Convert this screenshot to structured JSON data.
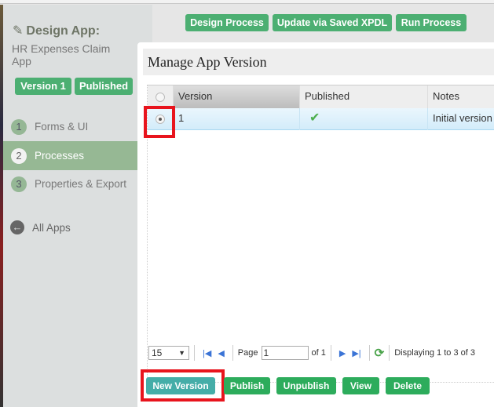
{
  "sidebar": {
    "title": "Design App:",
    "app_name": "HR Expenses Claim App",
    "version_badge": "Version 1",
    "published_badge": "Published",
    "nav": [
      {
        "num": "1",
        "label": "Forms & UI"
      },
      {
        "num": "2",
        "label": "Processes",
        "active": true
      },
      {
        "num": "3",
        "label": "Properties & Export"
      }
    ],
    "all_apps": "All Apps"
  },
  "toolbar": {
    "design_process": "Design Process",
    "update_xpdl": "Update via Saved XPDL",
    "run_process": "Run Process"
  },
  "modal": {
    "title": "Manage App Version",
    "columns": [
      "Version",
      "Published",
      "Notes"
    ],
    "rows": [
      {
        "version": "1",
        "published": true,
        "notes": "Initial version",
        "selected": true
      }
    ],
    "pager": {
      "page_size": "15",
      "page_label": "Page",
      "page_value": "1",
      "of_label": "of 1",
      "display_text": "Displaying 1 to 3 of 3"
    },
    "actions": {
      "new_version": "New Version",
      "publish": "Publish",
      "unpublish": "Unpublish",
      "view": "View",
      "delete": "Delete"
    }
  },
  "colors": {
    "accent_green": "#4caf72",
    "action_green": "#2dac5c",
    "new_version_teal": "#45ada8",
    "highlight_red": "#e8141d"
  }
}
